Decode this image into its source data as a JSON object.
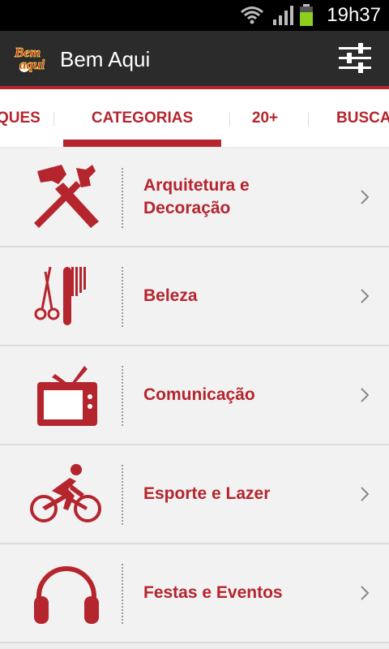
{
  "status_bar": {
    "time": "19h37"
  },
  "app_bar": {
    "logo_text": "Bem aqui",
    "title": "Bem Aqui"
  },
  "tabs": [
    {
      "label": "QUES"
    },
    {
      "label": "CATEGORIAS",
      "selected": true
    },
    {
      "label": "20+"
    },
    {
      "label": "BUSCA"
    }
  ],
  "categories": [
    {
      "label": "Arquitetura e Decoração",
      "icon": "hammer-wrench-icon"
    },
    {
      "label": "Beleza",
      "icon": "scissors-comb-icon"
    },
    {
      "label": "Comunicação",
      "icon": "television-icon"
    },
    {
      "label": "Esporte e Lazer",
      "icon": "cyclist-icon"
    },
    {
      "label": "Festas e Eventos",
      "icon": "headphones-icon"
    }
  ],
  "colors": {
    "accent": "#b5252e",
    "appbar": "#2b2b2b",
    "row_bg": "#f2f2f2"
  }
}
